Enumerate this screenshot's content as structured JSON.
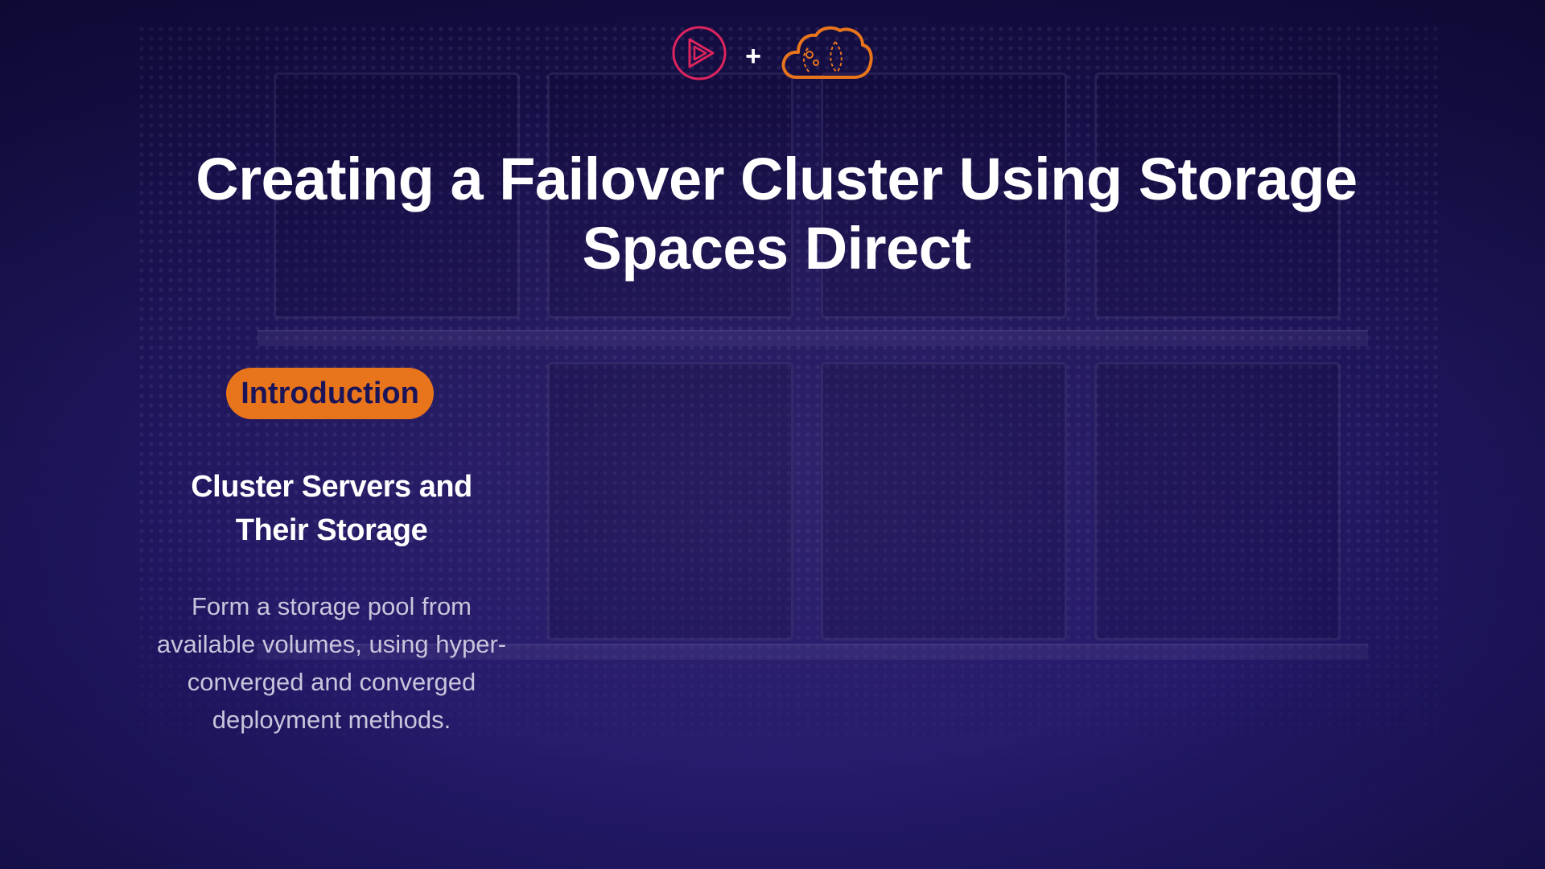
{
  "logos": {
    "left_icon": "play-icon",
    "separator": "+",
    "right_icon": "cloud-icon",
    "left_color": "#e0245e",
    "right_color": "#e8741c"
  },
  "title": "Creating a Failover Cluster Using Storage Spaces Direct",
  "section_badge": "Introduction",
  "subheading": "Cluster Servers and Their Storage",
  "body": "Form a storage pool from available volumes, using hyper-converged and converged deployment methods.",
  "colors": {
    "background": "#1c1458",
    "accent": "#e8741c",
    "title_text": "#ffffff",
    "body_text": "#c9c5dc"
  }
}
